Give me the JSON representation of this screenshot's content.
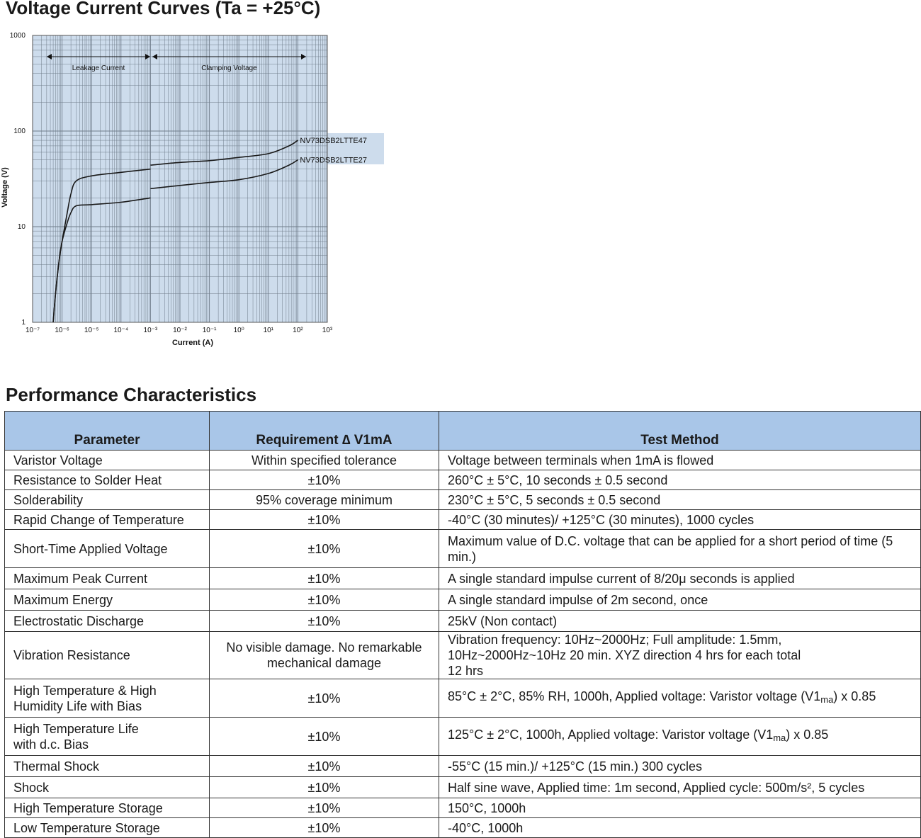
{
  "chart_title": "Voltage Current Curves (Ta = +25°C)",
  "chart_data": {
    "type": "line",
    "xlabel": "Current (A)",
    "ylabel": "Voltage (V)",
    "x_scale": "log",
    "y_scale": "log",
    "xlim": [
      1e-07,
      1000
    ],
    "ylim": [
      1,
      1000
    ],
    "x_tick_labels": [
      "10⁻⁷",
      "10⁻⁶",
      "10⁻⁵",
      "10⁻⁴",
      "10⁻³",
      "10⁻²",
      "10⁻¹",
      "10⁰",
      "10¹",
      "10²",
      "10³"
    ],
    "y_tick_labels": [
      "1",
      "10",
      "100",
      "1000"
    ],
    "grid": true,
    "region_annotations": [
      {
        "label": "Leakage Current",
        "from": 1e-07,
        "to": 0.001
      },
      {
        "label": "Clamping Voltage",
        "from": 0.001,
        "to": 100
      }
    ],
    "series": [
      {
        "name": "NV73DSB2LTTE47",
        "leakage": {
          "x": [
            5e-07,
            6e-07,
            8e-07,
            1e-06,
            1.5e-06,
            2e-06,
            3e-06,
            1e-05,
            0.0001,
            0.001
          ],
          "y": [
            1,
            2,
            4.5,
            7,
            14,
            22,
            30,
            34,
            37,
            40
          ]
        },
        "clamping": {
          "x": [
            0.001,
            0.01,
            0.1,
            1,
            10,
            50,
            100
          ],
          "y": [
            44,
            47,
            49,
            53,
            58,
            70,
            80
          ]
        }
      },
      {
        "name": "NV73DSB2LTTE27",
        "leakage": {
          "x": [
            5e-07,
            6e-07,
            8e-07,
            1e-06,
            1.5e-06,
            2e-06,
            3e-06,
            1e-05,
            0.0001,
            0.001
          ],
          "y": [
            1,
            2,
            4.5,
            7,
            11,
            14,
            16.5,
            17,
            18,
            20
          ]
        },
        "clamping": {
          "x": [
            0.001,
            0.01,
            0.1,
            1,
            10,
            50,
            100
          ],
          "y": [
            25,
            27,
            29,
            31,
            36,
            44,
            50
          ]
        }
      }
    ]
  },
  "table_title": "Performance Characteristics",
  "table": {
    "headers": [
      "Parameter",
      "Requirement ∆ V1mA",
      "Test Method"
    ],
    "rows": [
      {
        "param": "Varistor Voltage",
        "req": "Within specified tolerance",
        "method": "Voltage between terminals when 1mA is flowed"
      },
      {
        "param": "Resistance to Solder Heat",
        "req": "±10%",
        "method": "260°C ± 5°C, 10 seconds ± 0.5 second"
      },
      {
        "param": "Solderability",
        "req": "95% coverage minimum",
        "method": "230°C ± 5°C, 5 seconds ± 0.5 second"
      },
      {
        "param": "Rapid Change of Temperature",
        "req": "±10%",
        "method": "-40°C (30 minutes)/ +125°C (30 minutes), 1000 cycles"
      },
      {
        "param": "Short-Time Applied Voltage",
        "req": "±10%",
        "method": "Maximum value of D.C. voltage that can be applied for a short period of time (5 min.)"
      },
      {
        "param": "Maximum Peak Current",
        "req": "±10%",
        "method": "A single standard impulse current of 8/20μ seconds is applied"
      },
      {
        "param": "Maximum Energy",
        "req": "±10%",
        "method": "A single standard impulse of 2m second, once"
      },
      {
        "param": "Electrostatic Discharge",
        "req": "±10%",
        "method": "25kV (Non contact)"
      },
      {
        "param": "Vibration Resistance",
        "req": "No visible damage. No remarkable mechanical damage",
        "method": "Vibration frequency: 10Hz~2000Hz; Full amplitude: 1.5mm, 10Hz~2000Hz~10Hz 20 min. XYZ direction 4 hrs for each total 12 hrs"
      },
      {
        "param": "High Temperature & High Humidity Life with Bias",
        "req": "±10%",
        "method_pre": "85°C ± 2°C, 85% RH, 1000h, Applied voltage: Varistor voltage (V1",
        "method_sub": "ma",
        "method_post": ") x 0.85"
      },
      {
        "param": "High Temperature Life with d.c. Bias",
        "req": "±10%",
        "method_pre": "125°C ± 2°C, 1000h, Applied voltage: Varistor voltage (V1",
        "method_sub": "ma",
        "method_post": ") x 0.85"
      },
      {
        "param": "Thermal Shock",
        "req": "±10%",
        "method": "-55°C (15 min.)/ +125°C (15 min.) 300 cycles"
      },
      {
        "param": "Shock",
        "req": "±10%",
        "method": "Half sine wave, Applied time: 1m second, Applied cycle: 500m/s², 5 cycles"
      },
      {
        "param": "High Temperature Storage",
        "req": "±10%",
        "method": "150°C, 1000h"
      },
      {
        "param": "Low Temperature Storage",
        "req": "±10%",
        "method": "-40°C, 1000h"
      }
    ]
  },
  "colors": {
    "plot_bg": "#cddcec",
    "header_bg": "#a9c6e8",
    "grid": "#6f7c8a",
    "curve": "#1a1a1a"
  }
}
